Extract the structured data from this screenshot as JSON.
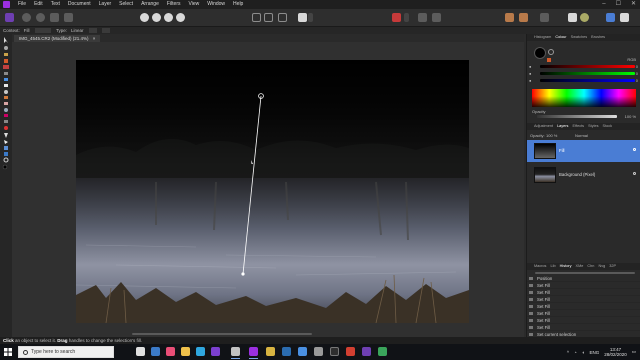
{
  "app": {
    "name": "Affinity Photo",
    "menu": [
      "File",
      "Edit",
      "Text",
      "Document",
      "Layer",
      "Select",
      "Arrange",
      "Filters",
      "View",
      "Window",
      "Help"
    ],
    "window_controls": [
      "–",
      "☐",
      "✕"
    ]
  },
  "context_bar": {
    "context_label": "Context:",
    "context_value": "Fill",
    "type_label": "Type:",
    "type_value": "Linear"
  },
  "document_tab": {
    "title": "IMG_4545.CR2 (Modified) (21.4%)",
    "close": "×"
  },
  "right_panel": {
    "top_tabs": [
      "Histogram",
      "Colour",
      "Swatches",
      "Brushes"
    ],
    "top_active": "Colour",
    "colour_mode": "RGB",
    "slider_values": [
      "0",
      "0",
      "0"
    ],
    "opacity_label": "Opacity",
    "opacity_value": "100 %",
    "layer_tabs": [
      "Adjustment",
      "Layers",
      "Effects",
      "Styles",
      "Stock"
    ],
    "layer_active": "Layers",
    "layers_opacity_label": "Opacity:",
    "layers_opacity_value": "100 %",
    "blend_mode": "Normal",
    "layers": [
      {
        "name": "Fill",
        "selected": true
      },
      {
        "name": "Background (Pixel)",
        "selected": false
      }
    ],
    "history_tabs": [
      "Macros",
      "Lib",
      "History",
      "XMe",
      "Chn",
      "Nvg",
      "32P"
    ],
    "history_active": "History",
    "history_items": [
      "Position",
      "Set Fill",
      "Set Fill",
      "Set Fill",
      "Set Fill",
      "Set Fill",
      "Set Fill",
      "Set Fill",
      "Set current selection",
      "Move fill handles"
    ],
    "history_active_index": 9
  },
  "status": {
    "text_parts": [
      "Click",
      " an object to select it. ",
      "Drag",
      " handles to change the selection's fill."
    ]
  },
  "taskbar": {
    "search_placeholder": "Type here to search",
    "time": "13:47",
    "date": "28/02/2020",
    "lang": "ENG"
  }
}
